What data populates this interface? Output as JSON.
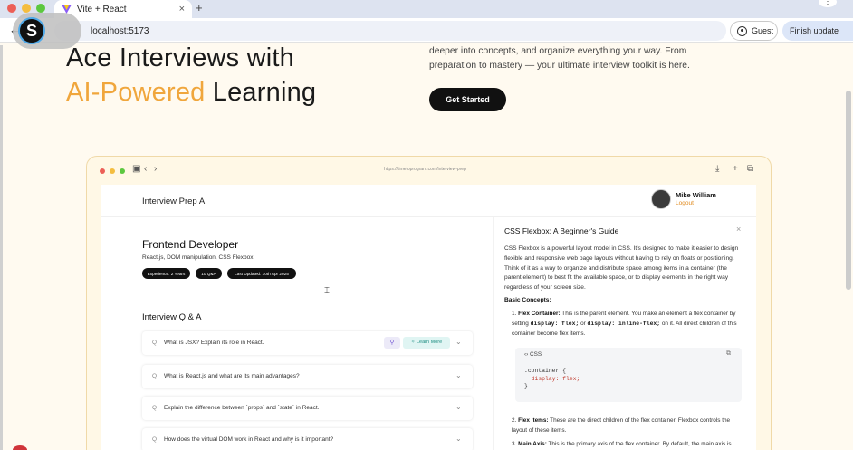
{
  "browser": {
    "tab_title": "Vite + React",
    "tab_close": "×",
    "new_tab": "+",
    "url": "localhost:5173",
    "guest_label": "Guest",
    "update_label": "Finish update",
    "menu_icon": "⋮",
    "logo_letter": "S"
  },
  "hero": {
    "line1": "Ace Interviews with",
    "line2_accent": "AI-Powered",
    "line2_rest": " Learning",
    "description": "deeper into concepts, and organize everything your way. From preparation to mastery — your ultimate interview toolkit is here.",
    "cta_label": "Get Started"
  },
  "preview": {
    "url": "https://timetoprogram.com/interview-prep",
    "app_name": "Interview Prep AI",
    "user_name": "Mike William",
    "logout_label": "Logout",
    "role": {
      "title": "Frontend Developer",
      "topics": "React.js, DOM manipulation, CSS Flexbox",
      "badges": [
        "Experience: 2 Years",
        "10 Q&A",
        "Last Updated: 30th Apr 2025"
      ]
    },
    "qa_title": "Interview Q & A",
    "q_mark": "Q",
    "learn_more": "Learn More",
    "questions": [
      "What is JSX? Explain its role in React.",
      "What is React.js and what are its main advantages?",
      "Explain the difference between `props` and `state` in React.",
      "How does the virtual DOM work in React and why is it important?"
    ],
    "panel": {
      "title": "CSS Flexbox: A Beginner's Guide",
      "close": "×",
      "intro": "CSS Flexbox is a powerful layout model in CSS. It's designed to make it easier to design flexible and responsive web page layouts without having to rely on floats or positioning. Think of it as a way to organize and distribute space among items in a container (the parent element) to best fit the available space, or to display elements in the right way regardless of your screen size.",
      "basic_concepts": "Basic Concepts:",
      "p1_label": "Flex Container:",
      "p1_a": " This is the parent element. You make an element a flex container by setting ",
      "p1_code1": "display: flex;",
      "p1_or": " or ",
      "p1_code2": "display: inline-flex;",
      "p1_b": " on it. All direct children of this container become flex items.",
      "code_lang": "CSS",
      "code_lines": [
        ".container {",
        "  display: flex;",
        "}"
      ],
      "p2_label": "Flex Items:",
      "p2_text": " These are the direct children of the flex container. Flexbox controls the layout of these items.",
      "p3_label": "Main Axis:",
      "p3_text": " This is the primary axis of the flex container. By default, the main axis is"
    }
  },
  "colors": {
    "accent_orange": "#f0a63c",
    "cta_black": "#111111",
    "logout_orange": "#e08a1e",
    "learn_teal": "#1f8f83"
  }
}
